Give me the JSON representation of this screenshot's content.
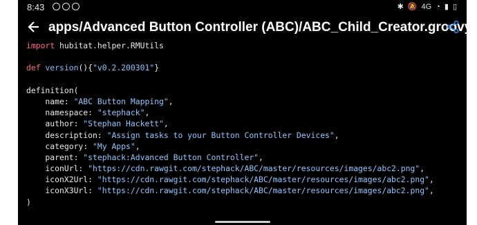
{
  "status": {
    "time": "8:43",
    "network": "4G"
  },
  "header": {
    "title": "apps/Advanced Button Controller (ABC)/ABC_Child_Creator.groovy"
  },
  "code": {
    "import_kw": "import",
    "import_rest": " hubitat.helper.RMUtils",
    "def_kw": "def",
    "def_fn": " version",
    "def_open": "(){",
    "def_str": "\"v0.2.200301\"",
    "def_close": "}",
    "definition_open": "definition(",
    "lines": [
      {
        "key": "    name: ",
        "val": "\"ABC Button Mapping\"",
        "end": ","
      },
      {
        "key": "    namespace: ",
        "val": "\"stephack\"",
        "end": ","
      },
      {
        "key": "    author: ",
        "val": "\"Stephan Hackett\"",
        "end": ","
      },
      {
        "key": "    description: ",
        "val": "\"Assign tasks to your Button Controller Devices\"",
        "end": ","
      },
      {
        "key": "    category: ",
        "val": "\"My Apps\"",
        "end": ","
      },
      {
        "key": "    parent: ",
        "val": "\"stephack:Advanced Button Controller\"",
        "end": ","
      },
      {
        "key": "    iconUrl: ",
        "val": "\"https://cdn.rawgit.com/stephack/ABC/master/resources/images/abc2.png\"",
        "end": ","
      },
      {
        "key": "    iconX2Url: ",
        "val": "\"https://cdn.rawgit.com/stephack/ABC/master/resources/images/abc2.png\"",
        "end": ","
      },
      {
        "key": "    iconX3Url: ",
        "val": "\"https://cdn.rawgit.com/stephack/ABC/master/resources/images/abc2.png\"",
        "end": ","
      }
    ],
    "definition_close": ")"
  },
  "colors": {
    "background": "#000000",
    "keyword": "#ff6b81",
    "string": "#8fc6ff",
    "function": "#8fb8ff"
  }
}
